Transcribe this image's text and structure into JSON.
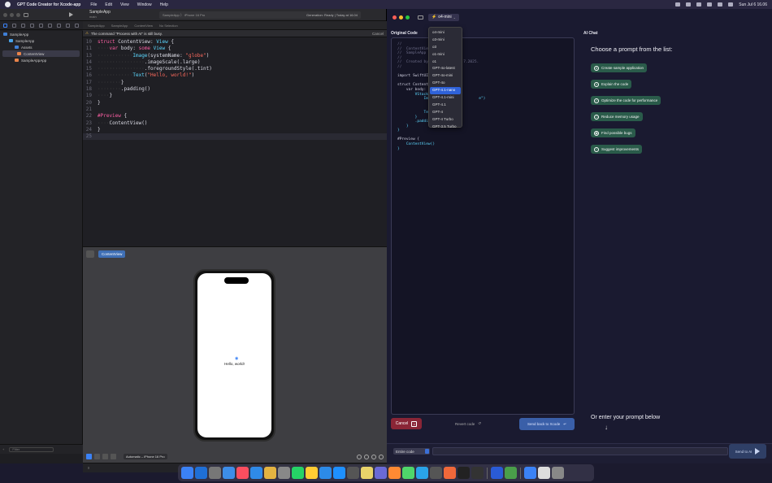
{
  "menubar": {
    "app_name": "GPT Code Creator for Xcode-app",
    "menus": [
      "File",
      "Edit",
      "View",
      "Window",
      "Help"
    ],
    "clock": "Sun Jul 6  16.06"
  },
  "xcode": {
    "project_name": "SampleApp",
    "project_sub": "main",
    "status_left": "SampleApp  〉  iPhone 16 Pro",
    "status_right": "Generation: Ready | Today at 16.04",
    "jumpbar": [
      "SampleApp",
      "SampleApp",
      "ContentView",
      "No Selection"
    ],
    "notice": "The command \"Process with AI\" is still busy.",
    "notice_cancel": "Cancel",
    "navigator": [
      {
        "label": "SampleApp",
        "indent": 0,
        "icon": "app-icon",
        "selected": false
      },
      {
        "label": "SampleApp",
        "indent": 1,
        "icon": "folder-icon",
        "selected": false
      },
      {
        "label": "Assets",
        "indent": 2,
        "icon": "assets-icon",
        "selected": false
      },
      {
        "label": "ContentView",
        "indent": 2,
        "icon": "swift-file-icon",
        "selected": true
      },
      {
        "label": "SampleAppApp",
        "indent": 2,
        "icon": "swift-file-icon",
        "selected": false
      }
    ],
    "filter_placeholder": "Filter",
    "code_lines": [
      {
        "n": "10",
        "segments": [
          [
            "kw",
            "struct "
          ],
          [
            "tx",
            "ContentView: "
          ],
          [
            "ty",
            "View"
          ],
          [
            "tx",
            " {"
          ]
        ]
      },
      {
        "n": "11",
        "segments": [
          [
            "dot",
            "····"
          ],
          [
            "kw",
            "var "
          ],
          [
            "tx",
            "body: "
          ],
          [
            "kw",
            "some "
          ],
          [
            "ty",
            "View"
          ],
          [
            "tx",
            " {"
          ]
        ]
      },
      {
        "n": "13",
        "segments": [
          [
            "dot",
            "············"
          ],
          [
            "ty",
            "Image"
          ],
          [
            "tx",
            "(systemName: "
          ],
          [
            "st",
            "\"globe\""
          ],
          [
            "tx",
            ")"
          ]
        ]
      },
      {
        "n": "14",
        "segments": [
          [
            "dot",
            "················"
          ],
          [
            "tx",
            ".imageScale(.large)"
          ]
        ]
      },
      {
        "n": "15",
        "segments": [
          [
            "dot",
            "················"
          ],
          [
            "tx",
            ".foregroundStyle(.tint)"
          ]
        ]
      },
      {
        "n": "16",
        "segments": [
          [
            "dot",
            "············"
          ],
          [
            "ty",
            "Text"
          ],
          [
            "tx",
            "("
          ],
          [
            "st",
            "\"Hello, world!\""
          ],
          [
            "tx",
            ")"
          ]
        ]
      },
      {
        "n": "17",
        "segments": [
          [
            "dot",
            "········"
          ],
          [
            "tx",
            "}"
          ]
        ]
      },
      {
        "n": "18",
        "segments": [
          [
            "dot",
            "········"
          ],
          [
            "tx",
            ".padding()"
          ]
        ]
      },
      {
        "n": "19",
        "segments": [
          [
            "dot",
            "····"
          ],
          [
            "tx",
            "}"
          ]
        ]
      },
      {
        "n": "20",
        "segments": [
          [
            "tx",
            "}"
          ]
        ]
      },
      {
        "n": "21",
        "segments": []
      },
      {
        "n": "22",
        "segments": [
          [
            "kw",
            "#Preview "
          ],
          [
            "tx",
            "{"
          ]
        ]
      },
      {
        "n": "23",
        "segments": [
          [
            "dot",
            "····"
          ],
          [
            "tx",
            "ContentView()"
          ]
        ]
      },
      {
        "n": "24",
        "segments": [
          [
            "tx",
            "}"
          ]
        ]
      },
      {
        "n": "25",
        "segments": []
      }
    ],
    "current_line": "25",
    "preview_tab": "ContentView",
    "preview_text": "Hello, world!",
    "device": "Automatic – iPhone 16 Pro",
    "cursor_pos": "Line: 25  Col: 1"
  },
  "gpt": {
    "model_selected": "o4-mini",
    "model_options": [
      "o4-mini",
      "o3-mini",
      "o3",
      "o1-mini",
      "o1",
      "GPT-4o-latest",
      "GPT-4o-mini",
      "GPT-4o",
      "GPT-4.1-nano",
      "GPT-4.1-mini",
      "GPT-4.1",
      "GPT-4",
      "GPT-4 Turbo",
      "GPT-3.5 Turbo"
    ],
    "model_highlighted": "GPT-4.1-nano",
    "original_code_title": "Original Code",
    "original_code_lines": [
      {
        "t": "//",
        "c": "cm"
      },
      {
        "t": "//  ContentView.swift",
        "c": "cm"
      },
      {
        "t": "//  SampleApp",
        "c": "cm"
      },
      {
        "t": "//",
        "c": "cm"
      },
      {
        "t": "//  Created by                7.2025.",
        "c": "cm"
      },
      {
        "t": "//",
        "c": "cm"
      },
      {
        "t": "",
        "c": ""
      },
      {
        "t": "import SwiftUI",
        "c": "kw"
      },
      {
        "t": "",
        "c": ""
      },
      {
        "t": "struct ContentV",
        "c": "kw"
      },
      {
        "t": "    var body: so",
        "c": "kw"
      },
      {
        "t": "        VStack {",
        "c": "ty"
      },
      {
        "t": "            Image(s                  e\")",
        "c": "ty"
      },
      {
        "t": "                .imag",
        "c": "ty"
      },
      {
        "t": "                .foreg",
        "c": "ty"
      },
      {
        "t": "            Text(\"H",
        "c": "ty"
      },
      {
        "t": "        }",
        "c": "ty"
      },
      {
        "t": "        .padding()",
        "c": "ty"
      },
      {
        "t": "    }",
        "c": "ty"
      },
      {
        "t": "}",
        "c": "ty"
      },
      {
        "t": "",
        "c": ""
      },
      {
        "t": "#Preview {",
        "c": "kw"
      },
      {
        "t": "    ContentView()",
        "c": "ty"
      },
      {
        "t": "}",
        "c": "ty"
      }
    ],
    "cancel_label": "Cancel",
    "revert_label": "Revert code",
    "send_xcode_label": "Send back to Xcode",
    "ai_chat_title": "AI Chat",
    "choose_title": "Choose a prompt from the list:",
    "prompts": [
      {
        "label": "Create sample application",
        "icon": "app-icon"
      },
      {
        "label": "Explain the code",
        "icon": "chat-icon"
      },
      {
        "label": "Optimize the code for performance",
        "icon": "gauge-icon"
      },
      {
        "label": "Reduce memory usage",
        "icon": "memory-icon"
      },
      {
        "label": "Find possible bugs",
        "icon": "bug-icon"
      },
      {
        "label": "Suggest improvements",
        "icon": "lightbulb-icon"
      }
    ],
    "or_enter": "Or enter your prompt below",
    "scope_value": "Entire code",
    "prompt_placeholder": "",
    "send_ai_label": "Send to AI"
  },
  "dock_apps": [
    "finder",
    "xcode",
    "launchpad",
    "mail",
    "music",
    "safari",
    "chrome",
    "settings",
    "whatsapp",
    "photos",
    "vscode",
    "appstore",
    "unity",
    "notes",
    "gpt-code-creator",
    "sublime",
    "messages",
    "telegram",
    "activity",
    "swift",
    "chatgpt",
    "terminal",
    "sourcetree",
    "maps",
    "files",
    "downloads",
    "trash"
  ],
  "dock_colors": [
    "#3b82f6",
    "#1f6fd6",
    "#777",
    "#3d8de8",
    "#fa4e5f",
    "#2f8ae8",
    "#e3b341",
    "#888",
    "#25d366",
    "#ffcc33",
    "#2c8be8",
    "#1e90ff",
    "#555",
    "#e8d36a",
    "#6a6ad6",
    "#ff8a33",
    "#4fd66a",
    "#2aa3e8",
    "#555",
    "#f0683a",
    "#222",
    "#333",
    "#2a5bd6",
    "#4a9e4a",
    "#3b82f6",
    "#ddd",
    "#888"
  ]
}
